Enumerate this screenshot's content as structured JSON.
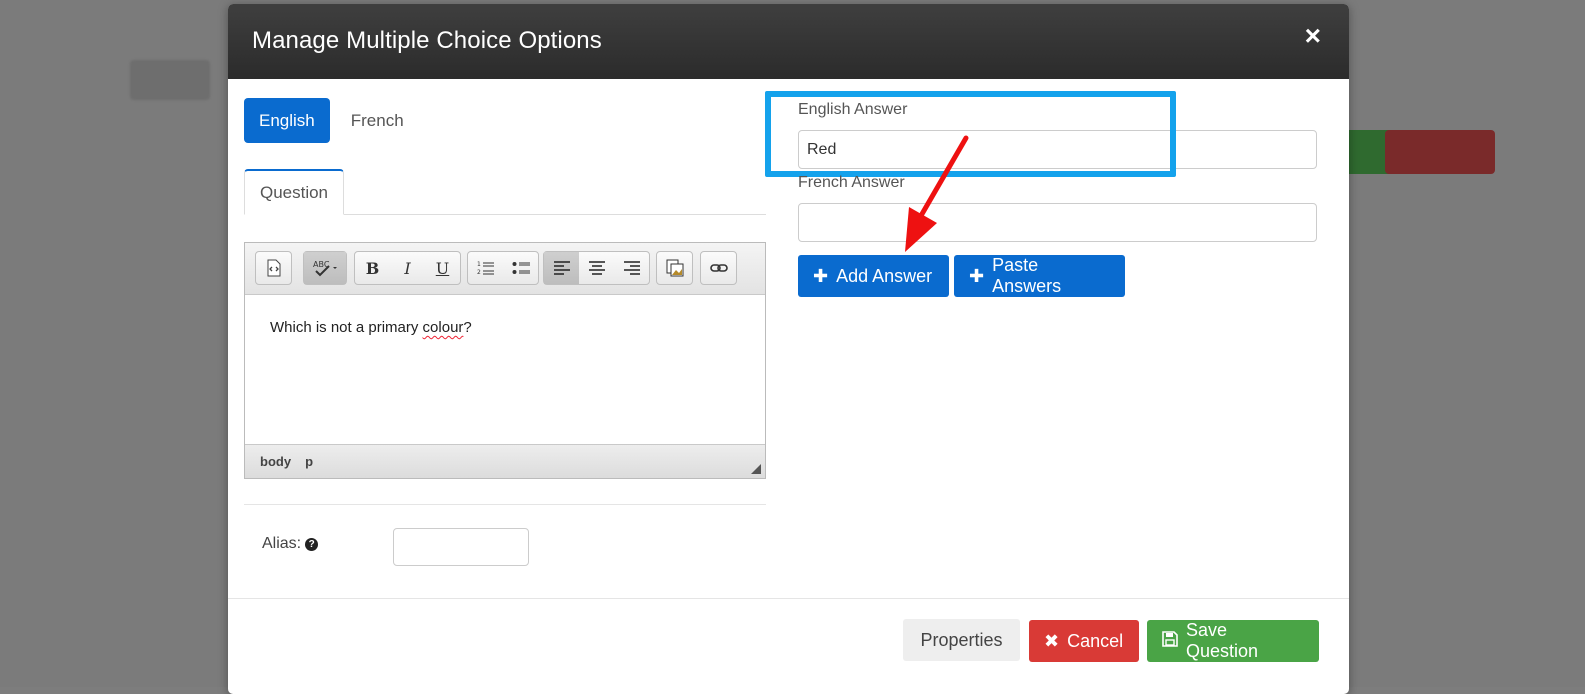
{
  "modal": {
    "title": "Manage Multiple Choice Options",
    "close_label": "×"
  },
  "language_tabs": [
    {
      "label": "English",
      "active": true
    },
    {
      "label": "French",
      "active": false
    }
  ],
  "question_tab": {
    "label": "Question"
  },
  "editor": {
    "toolbar_icons": [
      "source-icon",
      "spellcheck-icon",
      "bold-icon",
      "italic-icon",
      "underline-icon",
      "ordered-list-icon",
      "unordered-list-icon",
      "align-left-icon",
      "align-center-icon",
      "align-right-icon",
      "image-icon",
      "link-icon"
    ],
    "content_prefix": "Which is not a primary ",
    "content_misspelled": "colour",
    "content_suffix": "?",
    "status_path": [
      "body",
      "p"
    ]
  },
  "alias": {
    "label": "Alias:",
    "value": ""
  },
  "answers": {
    "english_label": "English Answer",
    "english_value": "Red",
    "french_label": "French Answer",
    "french_value": ""
  },
  "buttons": {
    "add_answer": "Add Answer",
    "paste_answers": "Paste Answers",
    "properties": "Properties",
    "cancel": "Cancel",
    "save": "Save Question"
  },
  "colors": {
    "header_bg": "#333333",
    "primary_blue": "#0a6bcf",
    "highlight_blue": "#14a2ec",
    "arrow_red": "#ee1111",
    "cancel_red": "#d93a36",
    "save_green": "#4aa446"
  }
}
